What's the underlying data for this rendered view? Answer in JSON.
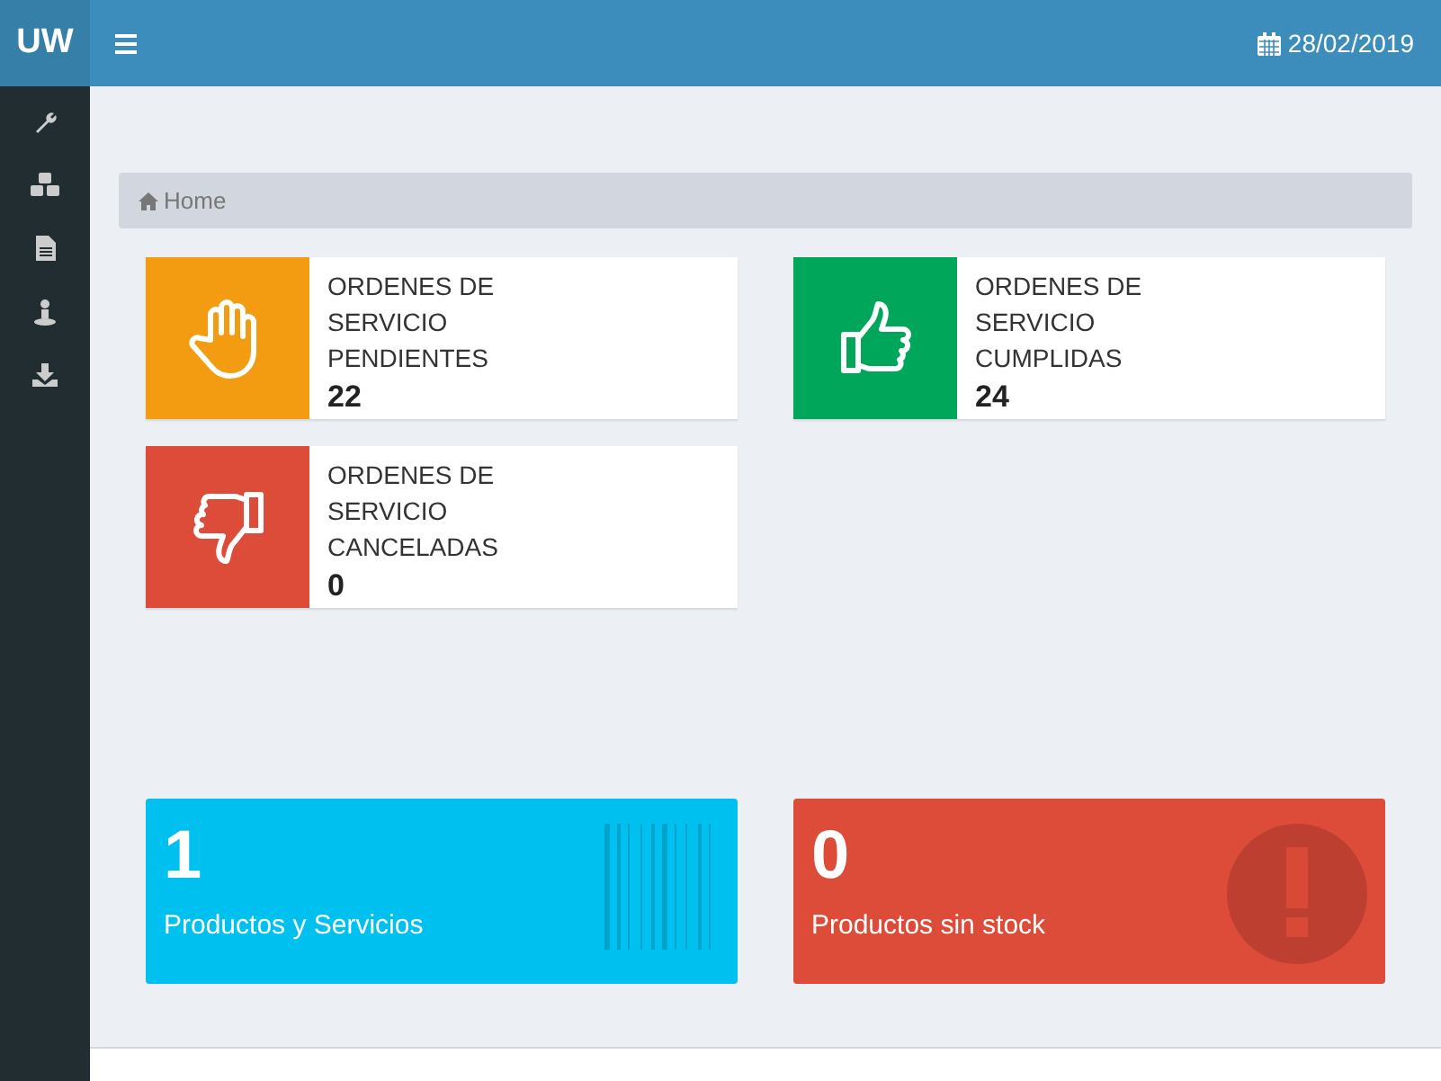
{
  "header": {
    "brand": "UW",
    "date": "28/02/2019"
  },
  "breadcrumb": {
    "label": "Home"
  },
  "info_boxes": [
    {
      "label": "ORDENES DE SERVICIO PENDIENTES",
      "count": "22",
      "color": "#f39c12",
      "kind": "hand"
    },
    {
      "label": "ORDENES DE SERVICIO CUMPLIDAS",
      "count": "24",
      "color": "#00a65a",
      "kind": "thumbs-up"
    },
    {
      "label": "ORDENES DE SERVICIO CANCELADAS",
      "count": "0",
      "color": "#dd4b39",
      "kind": "thumbs-down"
    }
  ],
  "stat_boxes": [
    {
      "number": "1",
      "label": "Productos y Servicios",
      "color": "#00c0ef",
      "kind": "barcode"
    },
    {
      "number": "0",
      "label": "Productos sin stock",
      "color": "#dd4b39",
      "kind": "alert"
    }
  ]
}
